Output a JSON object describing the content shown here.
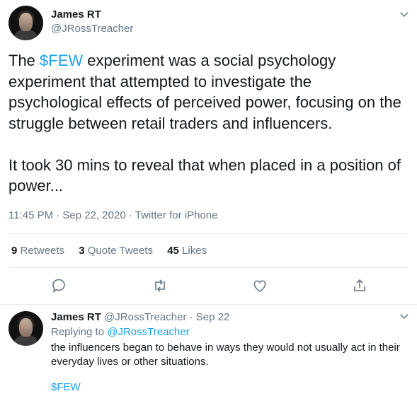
{
  "tweet": {
    "author_name": "James RT",
    "author_handle": "@JRossTreacher",
    "text_prefix": "The ",
    "cashtag": "$FEW",
    "text_line1_rest": " experiment was a social psychology experiment that attempted to investigate the psychological effects of perceived power, focusing on the struggle between retail traders and influencers.",
    "text_para2": "It took 30 mins to reveal that when placed in a position of power...",
    "timestamp": "11:45 PM · Sep 22, 2020 · Twitter for iPhone"
  },
  "stats": {
    "retweets_count": "9",
    "retweets_label": "Retweets",
    "quote_count": "3",
    "quote_label": "Quote Tweets",
    "likes_count": "45",
    "likes_label": "Likes"
  },
  "actions": [
    "reply-icon",
    "retweet-icon",
    "like-icon",
    "share-icon"
  ],
  "reply": {
    "author_name": "James RT",
    "author_handle": "@JRossTreacher",
    "date": "· Sep 22",
    "replying_prefix": "Replying to ",
    "replying_to": "@JRossTreacher",
    "text": "the influencers began to behave in ways they would not usually act in their everyday lives or other situations.",
    "cashtag": "$FEW"
  },
  "colors": {
    "link": "#1da1f2",
    "secondary_text": "#657786",
    "primary_text": "#14171a",
    "divider": "#e6ecf0"
  }
}
